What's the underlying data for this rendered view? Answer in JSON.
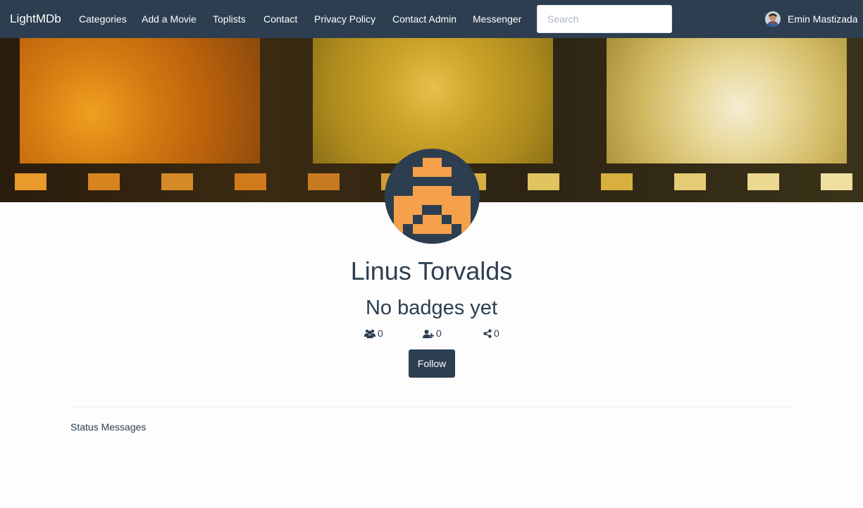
{
  "nav": {
    "brand": "LightMDb",
    "items": [
      "Categories",
      "Add a Movie",
      "Toplists",
      "Contact",
      "Privacy Policy",
      "Contact Admin",
      "Messenger"
    ],
    "search_placeholder": "Search",
    "user_name": "Emin Mastizada"
  },
  "profile": {
    "name": "Linus Torvalds",
    "badges_text": "No badges yet",
    "stats": {
      "followers": "0",
      "following": "0",
      "shares": "0"
    },
    "follow_label": "Follow"
  },
  "content": {
    "status_title": "Status Messages"
  },
  "colors": {
    "navbar": "#2c3e50",
    "text": "#2c3e50",
    "avatar_pixels": "#f5a04a",
    "background": "#fdfdfd"
  },
  "icons": {
    "followers": "users-icon",
    "following": "user-plus-icon",
    "shares": "share-alt-icon"
  }
}
